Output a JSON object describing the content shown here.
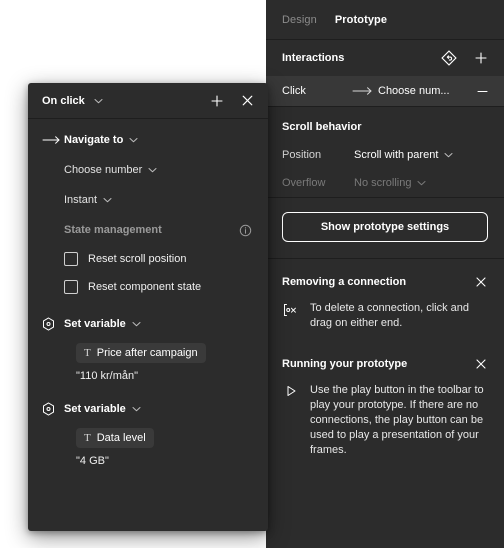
{
  "theme": {
    "panel_bg": "#2c2c2c",
    "row_selected_bg": "#383838",
    "divider": "#1e1e1e",
    "text": "#ffffff",
    "text_dim": "#8c8c8c",
    "chip_bg": "#3a3a3a",
    "canvas_bg": "#ffffff"
  },
  "sidebar": {
    "tabs": [
      {
        "label": "Design",
        "active": false
      },
      {
        "label": "Prototype",
        "active": true
      }
    ],
    "interactions": {
      "title": "Interactions",
      "reset_icon": "prototype-reset-icon",
      "add_icon": "plus-icon",
      "rows": [
        {
          "trigger": "Click",
          "arrow_icon": "arrow-right-icon",
          "destination": "Choose num...",
          "remove_icon": "minus-icon",
          "selected": true
        }
      ]
    },
    "scroll_behavior": {
      "title": "Scroll behavior",
      "properties": [
        {
          "label": "Position",
          "value": "Scroll with parent",
          "dim": false,
          "chevron": "chevron-down-icon"
        },
        {
          "label": "Overflow",
          "value": "No scrolling",
          "dim": true,
          "chevron": "chevron-down-icon"
        }
      ]
    },
    "prototype_settings_button": "Show prototype settings",
    "tips": [
      {
        "title": "Removing a connection",
        "close_icon": "close-icon",
        "icon": "delete-connection-icon",
        "text": "To delete a connection, click and drag on either end."
      },
      {
        "title": "Running your prototype",
        "close_icon": "close-icon",
        "icon": "play-icon",
        "text": "Use the play button in the toolbar to play your prototype. If there are no connections, the play button can be used to play a presentation of your frames."
      }
    ]
  },
  "modal": {
    "title": "On click",
    "title_chevron": "chevron-down-icon",
    "add_icon": "plus-icon",
    "close_icon": "close-icon",
    "navigate": {
      "icon": "arrow-right-icon",
      "action_label": "Navigate to",
      "action_chevron": "chevron-down-icon",
      "destination_label": "Choose number",
      "destination_chevron": "chevron-down-icon",
      "animation_label": "Instant",
      "animation_chevron": "chevron-down-icon"
    },
    "state_management": {
      "title": "State management",
      "info_icon": "info-icon",
      "checkboxes": [
        {
          "label": "Reset scroll position",
          "checked": false
        },
        {
          "label": "Reset component state",
          "checked": false
        }
      ]
    },
    "set_variables": [
      {
        "icon": "variable-hexagon-icon",
        "action_label": "Set variable",
        "action_chevron": "chevron-down-icon",
        "chip_icon": "text-type-icon",
        "chip_label": "Price after campaign",
        "value": "\"110 kr/mån\""
      },
      {
        "icon": "variable-hexagon-icon",
        "action_label": "Set variable",
        "action_chevron": "chevron-down-icon",
        "chip_icon": "text-type-icon",
        "chip_label": "Data level",
        "value": "\"4 GB\""
      }
    ]
  }
}
